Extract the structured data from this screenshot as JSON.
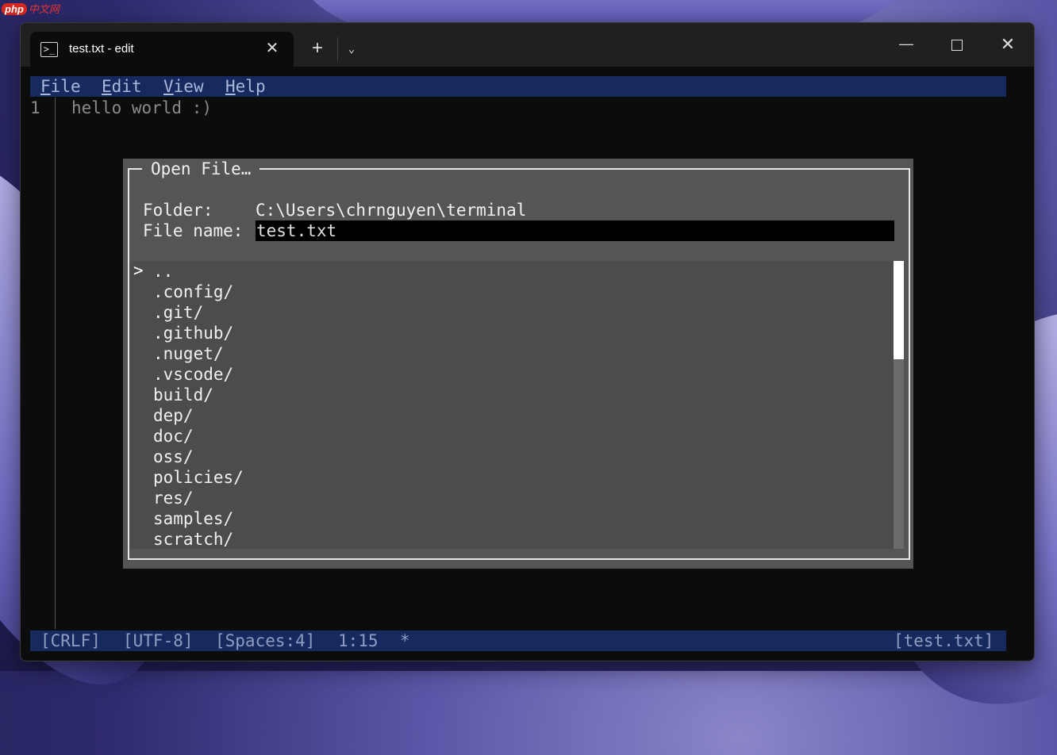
{
  "watermark": {
    "brand": "php",
    "text": "中文网"
  },
  "window": {
    "tab_title": "test.txt - edit",
    "tab_icon": "powershell-icon",
    "close_tab_symbol": "✕",
    "new_tab_symbol": "+",
    "dropdown_symbol": "⌄",
    "minimize_symbol": "—",
    "close_symbol": "✕"
  },
  "menubar": {
    "file": {
      "hotkey": "F",
      "rest": "ile"
    },
    "edit": {
      "hotkey": "E",
      "rest": "dit"
    },
    "view": {
      "hotkey": "V",
      "rest": "iew"
    },
    "help": {
      "hotkey": "H",
      "rest": "elp"
    }
  },
  "editor": {
    "line_number": "1",
    "line_text": "hello world :)"
  },
  "dialog": {
    "title": "Open File…",
    "folder_label": "Folder:",
    "folder_value": "C:\\Users\\chrnguyen\\terminal",
    "filename_label": "File name:",
    "filename_value": "test.txt",
    "cursor": ">",
    "entries": [
      "..",
      ".config/",
      ".git/",
      ".github/",
      ".nuget/",
      ".vscode/",
      "build/",
      "dep/",
      "doc/",
      "oss/",
      "policies/",
      "res/",
      "samples/",
      "scratch/"
    ]
  },
  "statusbar": {
    "line_ending": "[CRLF]",
    "encoding": "[UTF-8]",
    "indent": "[Spaces:4]",
    "position": "1:15",
    "modified": "*",
    "filename": "[test.txt]"
  },
  "colors": {
    "menubar_bg": "#172a60",
    "dialog_bg": "#555555",
    "terminal_bg": "#0c0c0c"
  }
}
